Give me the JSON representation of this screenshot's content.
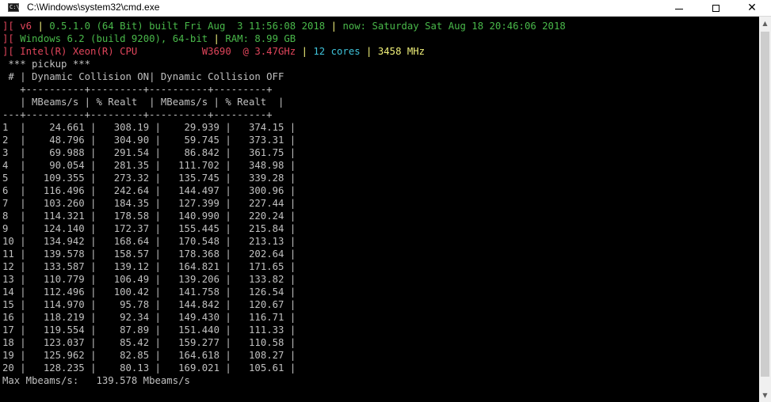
{
  "window": {
    "title": "C:\\Windows\\system32\\cmd.exe",
    "icon_text": "C:\\",
    "close_glyph": "✕"
  },
  "header": {
    "line1": {
      "prefix": "][",
      "ver_label": "v6",
      "sep1": "|",
      "build": "0.5.1.0 (64 Bit) built Fri Aug  3 11:56:08 2018",
      "sep2": "|",
      "now": "now: Saturday Sat Aug 18 20:46:06 2018"
    },
    "line2": {
      "prefix": "][",
      "os": "Windows 6.2 (build 9200), 64-bit",
      "sep": "|",
      "ram": "RAM: 8.99 GB"
    },
    "line3": {
      "prefix": "][",
      "cpu": "Intel(R) Xeon(R) CPU           W3690  @ 3.47GHz",
      "sep1": "|",
      "cores": "12 cores",
      "sep2": "|",
      "mhz": "3458 MHz"
    }
  },
  "table": {
    "title": " *** pickup ***",
    "header1": " # | Dynamic Collision ON| Dynamic Collision OFF",
    "rule1": "   +----------+---------+----------+---------+",
    "header2": "   | MBeams/s | % Realt  | MBeams/s | % Realt  |",
    "rule2": "---+----------+---------+----------+---------+",
    "rows": [
      {
        "n": "1",
        "on_mbeams": "24.661",
        "on_realt": "308.19",
        "off_mbeams": "29.939",
        "off_realt": "374.15"
      },
      {
        "n": "2",
        "on_mbeams": "48.796",
        "on_realt": "304.90",
        "off_mbeams": "59.745",
        "off_realt": "373.31"
      },
      {
        "n": "3",
        "on_mbeams": "69.988",
        "on_realt": "291.54",
        "off_mbeams": "86.842",
        "off_realt": "361.75"
      },
      {
        "n": "4",
        "on_mbeams": "90.054",
        "on_realt": "281.35",
        "off_mbeams": "111.702",
        "off_realt": "348.98"
      },
      {
        "n": "5",
        "on_mbeams": "109.355",
        "on_realt": "273.32",
        "off_mbeams": "135.745",
        "off_realt": "339.28"
      },
      {
        "n": "6",
        "on_mbeams": "116.496",
        "on_realt": "242.64",
        "off_mbeams": "144.497",
        "off_realt": "300.96"
      },
      {
        "n": "7",
        "on_mbeams": "103.260",
        "on_realt": "184.35",
        "off_mbeams": "127.399",
        "off_realt": "227.44"
      },
      {
        "n": "8",
        "on_mbeams": "114.321",
        "on_realt": "178.58",
        "off_mbeams": "140.990",
        "off_realt": "220.24"
      },
      {
        "n": "9",
        "on_mbeams": "124.140",
        "on_realt": "172.37",
        "off_mbeams": "155.445",
        "off_realt": "215.84"
      },
      {
        "n": "10",
        "on_mbeams": "134.942",
        "on_realt": "168.64",
        "off_mbeams": "170.548",
        "off_realt": "213.13"
      },
      {
        "n": "11",
        "on_mbeams": "139.578",
        "on_realt": "158.57",
        "off_mbeams": "178.368",
        "off_realt": "202.64"
      },
      {
        "n": "12",
        "on_mbeams": "133.587",
        "on_realt": "139.12",
        "off_mbeams": "164.821",
        "off_realt": "171.65"
      },
      {
        "n": "13",
        "on_mbeams": "110.779",
        "on_realt": "106.49",
        "off_mbeams": "139.206",
        "off_realt": "133.82"
      },
      {
        "n": "14",
        "on_mbeams": "112.496",
        "on_realt": "100.42",
        "off_mbeams": "141.758",
        "off_realt": "126.54"
      },
      {
        "n": "15",
        "on_mbeams": "114.970",
        "on_realt": "95.78",
        "off_mbeams": "144.842",
        "off_realt": "120.67"
      },
      {
        "n": "16",
        "on_mbeams": "118.219",
        "on_realt": "92.34",
        "off_mbeams": "149.430",
        "off_realt": "116.71"
      },
      {
        "n": "17",
        "on_mbeams": "119.554",
        "on_realt": "87.89",
        "off_mbeams": "151.440",
        "off_realt": "111.33"
      },
      {
        "n": "18",
        "on_mbeams": "123.037",
        "on_realt": "85.42",
        "off_mbeams": "159.277",
        "off_realt": "110.58"
      },
      {
        "n": "19",
        "on_mbeams": "125.962",
        "on_realt": "82.85",
        "off_mbeams": "164.618",
        "off_realt": "108.27"
      },
      {
        "n": "20",
        "on_mbeams": "128.235",
        "on_realt": "80.13",
        "off_mbeams": "169.021",
        "off_realt": "105.61"
      }
    ],
    "footer": "Max Mbeams/s:   139.578 Mbeams/s"
  },
  "colors": {
    "background": "#000000",
    "text": "#c0c0c0",
    "red": "#e0455b",
    "green": "#49b84a",
    "cyan": "#3fc3da",
    "yellow": "#f1f17a"
  }
}
